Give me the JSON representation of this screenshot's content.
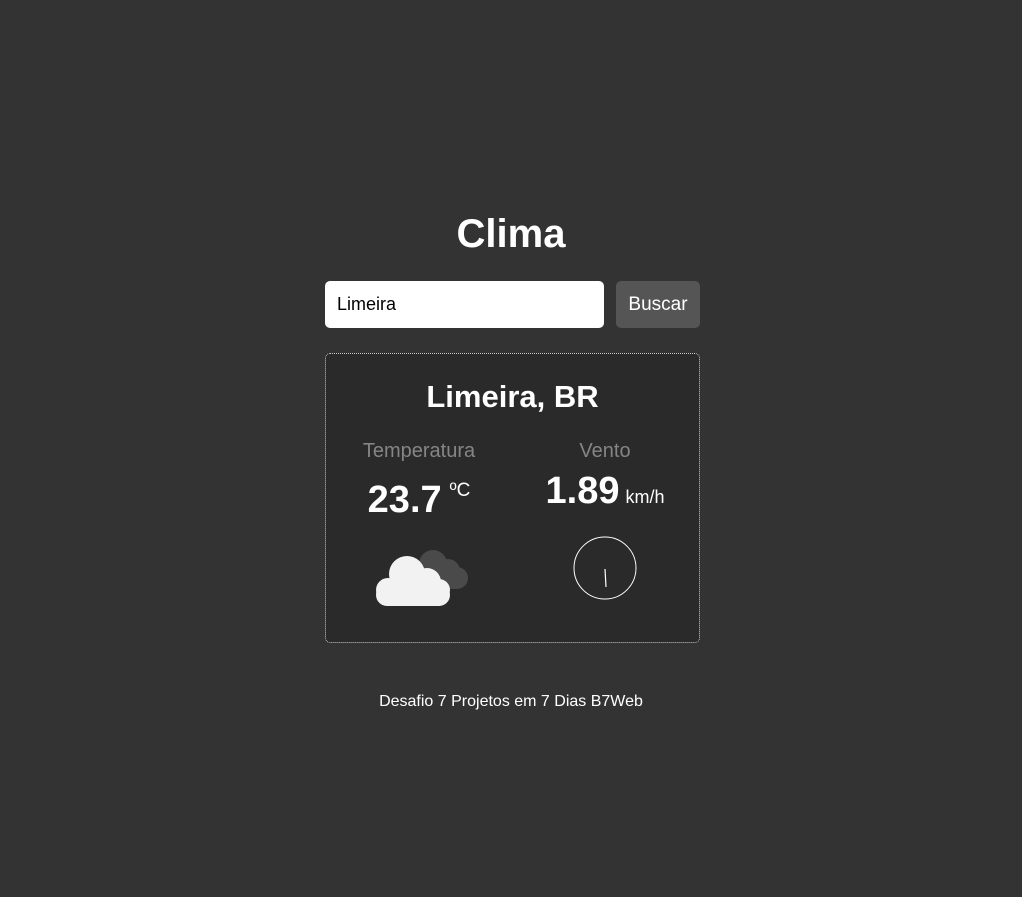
{
  "header": {
    "title": "Clima"
  },
  "search": {
    "value": "Limeira",
    "button_label": "Buscar"
  },
  "result": {
    "location": "Limeira, BR",
    "temperature": {
      "label": "Temperatura",
      "value": "23.7",
      "unit": "ºC"
    },
    "wind": {
      "label": "Vento",
      "value": "1.89",
      "unit": "km/h"
    },
    "weather_icon": "cloud-icon",
    "wind_direction_icon": "wind-direction-gauge-icon"
  },
  "footer": {
    "text": "Desafio 7 Projetos em 7 Dias B7Web"
  },
  "colors": {
    "background": "#333333",
    "card_background": "#2a2a2a",
    "button_background": "#555555",
    "label_gray": "#858585"
  }
}
